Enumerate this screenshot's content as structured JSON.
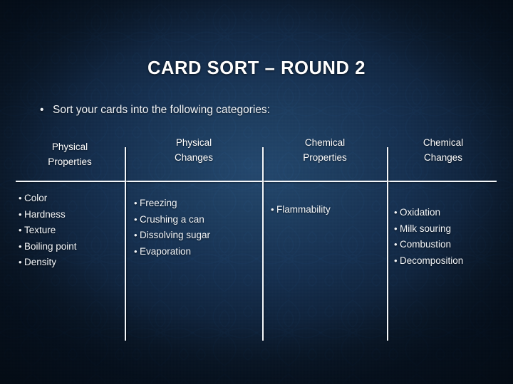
{
  "slide": {
    "title": "CARD SORT – ROUND 2",
    "subtitle": "Sort your cards into the following categories:",
    "bullet_glyph": "•",
    "colors": {
      "text": "#ffffff",
      "rule": "#f4f7fa",
      "background_center": "#24486e",
      "background_edge": "#061221"
    }
  },
  "columns": [
    {
      "header_line1": "Physical",
      "header_line2": "Properties",
      "items": [
        "Color",
        "Hardness",
        "Texture",
        "Boiling point",
        "Density"
      ]
    },
    {
      "header_line1": "Physical",
      "header_line2": "Changes",
      "items": [
        "Freezing",
        "Crushing a can",
        "Dissolving sugar",
        "Evaporation"
      ]
    },
    {
      "header_line1": "Chemical",
      "header_line2": "Properties",
      "items": [
        "Flammability"
      ]
    },
    {
      "header_line1": "Chemical",
      "header_line2": "Changes",
      "items": [
        "Oxidation",
        "Milk souring",
        "Combustion",
        "Decomposition"
      ]
    }
  ]
}
